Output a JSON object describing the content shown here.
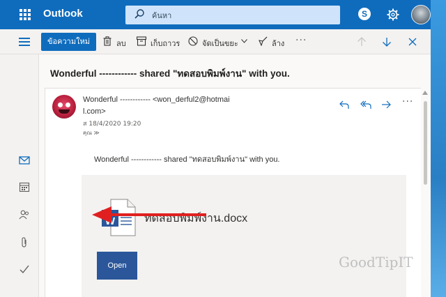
{
  "header": {
    "app_name": "Outlook",
    "search_placeholder": "ค้นหา",
    "skype_letter": "S"
  },
  "commands": {
    "new_message": "ข้อความใหม่",
    "delete": "ลบ",
    "archive": "เก็บถาวร",
    "junk": "จัดเป็นขยะ",
    "sweep": "ล้าง",
    "more": "···"
  },
  "message": {
    "subject": "Wonderful ------------ shared \"ทดสอบพิมพ์งาน\" with you.",
    "from_line1": "Wonderful ------------ <won_derful2@hotmai",
    "from_line2": "l.com>",
    "date": "ส 18/4/2020 19:20",
    "to": "คุณ ≫",
    "more": "···",
    "body": "Wonderful ------------ shared \"ทดสอบพิมพ์งาน\" with you.",
    "file_name": "ทดสอบพิมพ์งาน.docx",
    "open_label": "Open",
    "word_letter": "W"
  },
  "watermark": "GoodTipIT",
  "colors": {
    "brand_blue": "#0f6cbd",
    "word_blue": "#2b579a",
    "arrow_red": "#e02020"
  }
}
